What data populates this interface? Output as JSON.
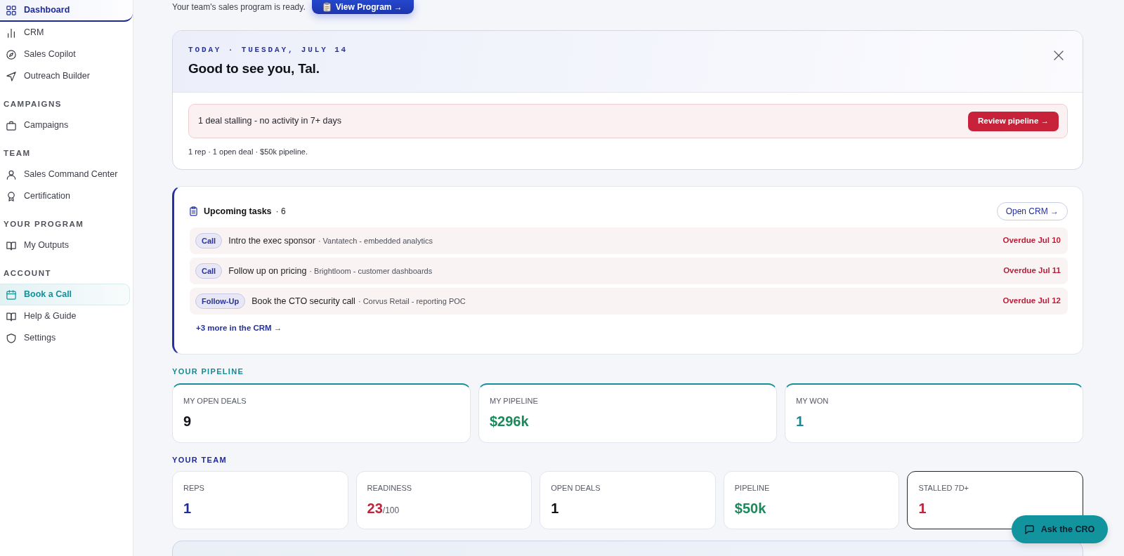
{
  "sidebar": {
    "sections": [
      {
        "items": [
          {
            "label": "Dashboard",
            "selected": true,
            "highlighted": false
          },
          {
            "label": "CRM",
            "selected": false,
            "highlighted": false
          },
          {
            "label": "Sales Copilot",
            "selected": false,
            "highlighted": false
          },
          {
            "label": "Outreach Builder",
            "selected": false,
            "highlighted": false
          }
        ]
      },
      {
        "heading": "CAMPAIGNS",
        "items": [
          {
            "label": "Campaigns",
            "selected": false,
            "highlighted": false
          }
        ]
      },
      {
        "heading": "TEAM",
        "items": [
          {
            "label": "Sales Command Center",
            "selected": false,
            "highlighted": false
          },
          {
            "label": "Certification",
            "selected": false,
            "highlighted": false
          }
        ]
      },
      {
        "heading": "YOUR PROGRAM",
        "items": [
          {
            "label": "My Outputs",
            "selected": false,
            "highlighted": false
          }
        ]
      },
      {
        "heading": "ACCOUNT",
        "items": [
          {
            "label": "Book a Call",
            "selected": false,
            "highlighted": true
          },
          {
            "label": "Help & Guide",
            "selected": false,
            "highlighted": false
          },
          {
            "label": "Settings",
            "selected": false,
            "highlighted": false
          }
        ]
      }
    ]
  },
  "banner": {
    "text": "Your team's sales program is ready.",
    "button": "View Program →"
  },
  "welcome": {
    "date": "TODAY · TUESDAY, JULY 14",
    "greeting": "Good to see you, Tal.",
    "alert": {
      "text": "1 deal stalling - no activity in 7+ days",
      "button": "Review pipeline →"
    },
    "summary": "1 rep · 1 open deal · $50k pipeline."
  },
  "tasks": {
    "title": "Upcoming tasks",
    "count": "· 6",
    "button": "Open CRM →",
    "items": [
      {
        "type": "Call",
        "title": "Intro the exec sponsor",
        "detail": "· Vantatech - embedded analytics",
        "due": "Overdue Jul 10"
      },
      {
        "type": "Call",
        "title": "Follow up on pricing",
        "detail": "· Brightloom - customer dashboards",
        "due": "Overdue Jul 11"
      },
      {
        "type": "Follow-Up",
        "title": "Book the CTO security call",
        "detail": "· Corvus Retail - reporting POC",
        "due": "Overdue Jul 12"
      }
    ],
    "more": "+3 more in the CRM →"
  },
  "pipeline": {
    "heading": "YOUR PIPELINE",
    "stats": [
      {
        "label": "MY OPEN DEALS",
        "value": "9",
        "color": "#111116"
      },
      {
        "label": "MY PIPELINE",
        "value": "$296k",
        "color": "#1a8a5c"
      },
      {
        "label": "MY WON",
        "value": "1",
        "color": "#168a94"
      }
    ]
  },
  "team": {
    "heading": "YOUR TEAM",
    "stats": [
      {
        "label": "REPS",
        "value": "1",
        "color": "#1f2a9c",
        "outlined": false
      },
      {
        "label": "READINESS",
        "value": "23",
        "suffix": "/100",
        "color": "#c4213a",
        "outlined": false
      },
      {
        "label": "OPEN DEALS",
        "value": "1",
        "color": "#111116",
        "outlined": false
      },
      {
        "label": "PIPELINE",
        "value": "$50k",
        "color": "#1a8a5c",
        "outlined": false
      },
      {
        "label": "STALLED 7D+",
        "value": "1",
        "color": "#c4213a",
        "outlined": true
      }
    ]
  },
  "assistant_button": {
    "label": "Ask the CRO"
  }
}
